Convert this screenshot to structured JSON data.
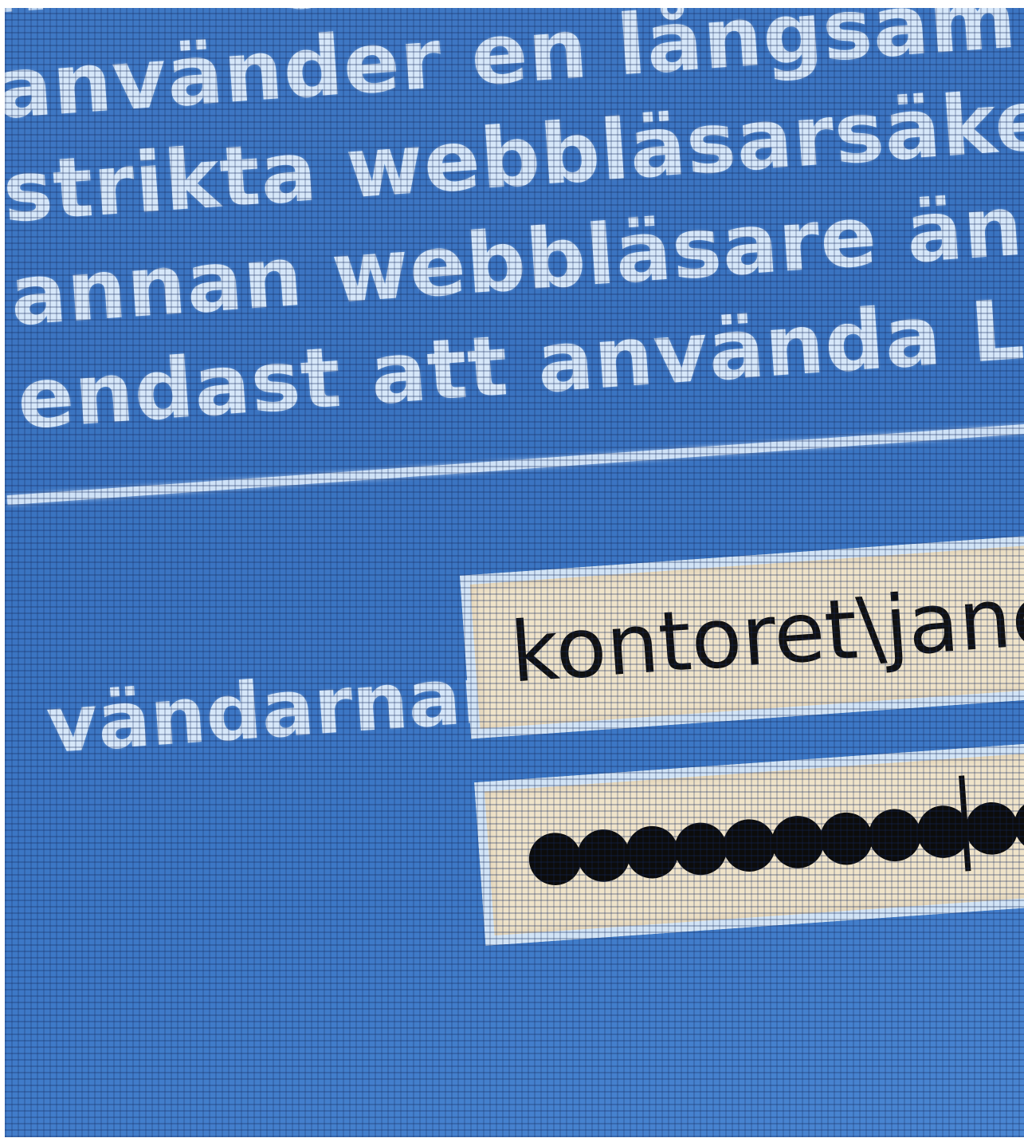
{
  "message": {
    "lines": [
      "ntering/vara",
      "använder en långsam anslutning",
      "strikta webbläsarsäkerhetsinställningar",
      "annan webbläsare än Internet Explorer",
      "endast att använda Light-klienten"
    ]
  },
  "login": {
    "username_label": "vändarnamn:",
    "username_value": "kontoret\\janerik",
    "password_mask": "●●●●●●●●●●●●●●●"
  },
  "colors": {
    "background": "#3d78c6",
    "text": "#d6e7f9",
    "field": "#efe3c9"
  }
}
